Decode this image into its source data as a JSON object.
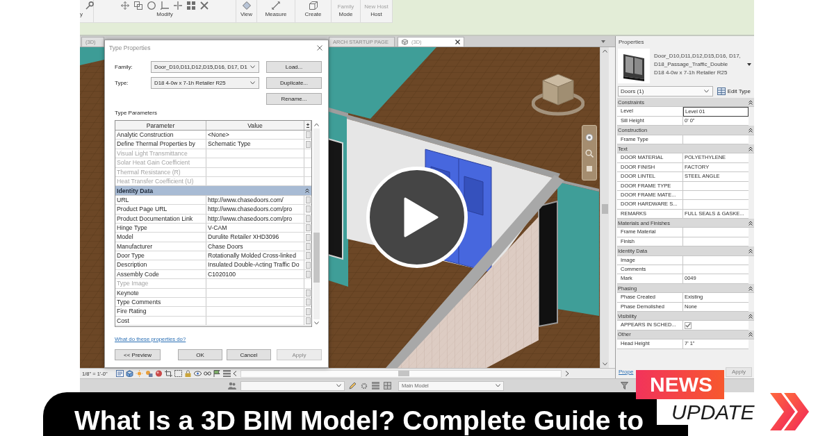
{
  "ribbon": {
    "panels": [
      {
        "label": "y"
      },
      {
        "label": "Modify"
      },
      {
        "label": "View"
      },
      {
        "label": "Measure"
      },
      {
        "label": "Create"
      },
      {
        "label": "Mode",
        "button": {
          "label": "Family",
          "disabled": true
        }
      },
      {
        "label": "Host",
        "button": {
          "label": "New Host",
          "disabled": true
        }
      }
    ]
  },
  "view_tabs": [
    {
      "label": "(3D)",
      "selected": false
    },
    {
      "label": "ARCH STARTUP PAGE",
      "selected": false
    },
    {
      "label": "(3D)",
      "selected": true
    }
  ],
  "type_properties_dialog": {
    "title": "Type Properties",
    "family": {
      "label": "Family:",
      "value": "Door_D10,D11,D12,D15,D16, D17, D1"
    },
    "type": {
      "label": "Type:",
      "value": "D18 4-0w x 7-1h Retailer R25"
    },
    "side_buttons": [
      "Load...",
      "Duplicate...",
      "Rename..."
    ],
    "section_label": "Type Parameters",
    "columns": [
      "Parameter",
      "Value"
    ],
    "sections": [
      {
        "rows": [
          {
            "name": "Analytic Construction",
            "value": "<None>",
            "disabled": false
          },
          {
            "name": "Define Thermal Properties by",
            "value": "Schematic Type",
            "disabled": false
          },
          {
            "name": "Visual Light Transmittance",
            "disabled": true
          },
          {
            "name": "Solar Heat Gain Coefficient",
            "disabled": true
          },
          {
            "name": "Thermal Resistance (R)",
            "disabled": true
          },
          {
            "name": "Heat Transfer Coefficient (U)",
            "disabled": true
          }
        ]
      },
      {
        "name": "Identity Data",
        "expanded": true,
        "rows": [
          {
            "name": "URL",
            "value": "http://www.chasedoors.com/",
            "disabled": false
          },
          {
            "name": "Product Page URL",
            "value": "http://www.chasedoors.com/pro",
            "disabled": false
          },
          {
            "name": "Product Documentation Link",
            "value": "http://www.chasedoors.com/pro",
            "disabled": false
          },
          {
            "name": "Hinge Type",
            "value": "V-CAM",
            "disabled": false
          },
          {
            "name": "Model",
            "value": "Durulite Retailer XHD3096",
            "disabled": false
          },
          {
            "name": "Manufacturer",
            "value": "Chase Doors",
            "disabled": false
          },
          {
            "name": "Door Type",
            "value": "Rotationally Molded Cross-linked",
            "disabled": false
          },
          {
            "name": "Description",
            "value": "Insulated Double-Acting Traffic Do",
            "disabled": false
          },
          {
            "name": "Assembly Code",
            "value": "C1020100",
            "disabled": false
          },
          {
            "name": "Type Image",
            "disabled": true
          },
          {
            "name": "Keynote",
            "disabled": false
          },
          {
            "name": "Type Comments",
            "disabled": false
          },
          {
            "name": "Fire Rating",
            "disabled": false
          },
          {
            "name": "Cost",
            "disabled": false
          }
        ]
      }
    ],
    "help_link": "What do these properties do?",
    "buttons": [
      {
        "label": "<< Preview",
        "disabled": false
      },
      {
        "label": "OK",
        "disabled": false
      },
      {
        "label": "Cancel",
        "disabled": false
      },
      {
        "label": "Apply",
        "disabled": true
      }
    ]
  },
  "properties": {
    "title": "Properties",
    "type_name": [
      "Door_D10,D11,D12,D15,D16, D17,",
      "D18_Passage_Traffic_Double",
      "D18 4-0w x 7-1h Retailer R25"
    ],
    "selection": "Doors (1)",
    "edit_type": "Edit Type",
    "groups": [
      {
        "name": "Constraints",
        "expanded": true,
        "rows": [
          {
            "kind": "text",
            "name": "Level",
            "value": "Level 01",
            "selected": true
          },
          {
            "kind": "text",
            "name": "Sill Height",
            "value": "0' 0\"",
            "selected": false
          }
        ]
      },
      {
        "name": "Construction",
        "expanded": true,
        "rows": [
          {
            "kind": "text",
            "name": "Frame Type",
            "selected": false
          }
        ]
      },
      {
        "name": "Text",
        "expanded": true,
        "rows": [
          {
            "kind": "text",
            "name": "DOOR MATERIAL",
            "value": "POLYETHYLENE",
            "selected": false
          },
          {
            "kind": "text",
            "name": "DOOR FINISH",
            "value": "FACTORY",
            "selected": false
          },
          {
            "kind": "text",
            "name": "DOOR LINTEL",
            "value": "STEEL ANGLE",
            "selected": false
          },
          {
            "kind": "text",
            "name": "DOOR FRAME TYPE",
            "selected": false
          },
          {
            "kind": "text",
            "name": "DOOR FRAME MATE...",
            "selected": false
          },
          {
            "kind": "text",
            "name": "DOOR HARDWARE S...",
            "selected": false
          },
          {
            "kind": "text",
            "name": "REMARKS",
            "value": "FULL SEALS & GASKE...",
            "selected": false
          }
        ]
      },
      {
        "name": "Materials and Finishes",
        "expanded": true,
        "rows": [
          {
            "kind": "text",
            "name": "Frame Material",
            "selected": false
          },
          {
            "kind": "text",
            "name": "Finish",
            "selected": false
          }
        ]
      },
      {
        "name": "Identity Data",
        "expanded": true,
        "rows": [
          {
            "kind": "text",
            "name": "Image",
            "selected": false
          },
          {
            "kind": "text",
            "name": "Comments",
            "selected": false
          },
          {
            "kind": "text",
            "name": "Mark",
            "value": "0049",
            "selected": false
          }
        ]
      },
      {
        "name": "Phasing",
        "expanded": true,
        "rows": [
          {
            "kind": "text",
            "name": "Phase Created",
            "value": "Existing",
            "selected": false
          },
          {
            "kind": "text",
            "name": "Phase Demolished",
            "value": "None",
            "selected": false
          }
        ]
      },
      {
        "name": "Visibility",
        "expanded": true,
        "rows": [
          {
            "kind": "check",
            "name": "APPEARS IN SCHED...",
            "checked": true,
            "disabled": true,
            "selected": false
          }
        ]
      },
      {
        "name": "Other",
        "expanded": true,
        "rows": [
          {
            "kind": "text",
            "name": "Head Height",
            "value": "7' 1\"",
            "selected": false
          }
        ]
      }
    ],
    "help_link": "Prope",
    "apply": {
      "label": "Apply",
      "disabled": true
    }
  },
  "view_control_bar": {
    "scale": "1/8\" = 1'-0\""
  },
  "status_bar": {
    "model": "Main Model"
  },
  "banner": {
    "title": "What Is a 3D BIM Model? Complete Guide to"
  },
  "badge": {
    "top": "NEWS",
    "bottom": "UPDATE"
  }
}
